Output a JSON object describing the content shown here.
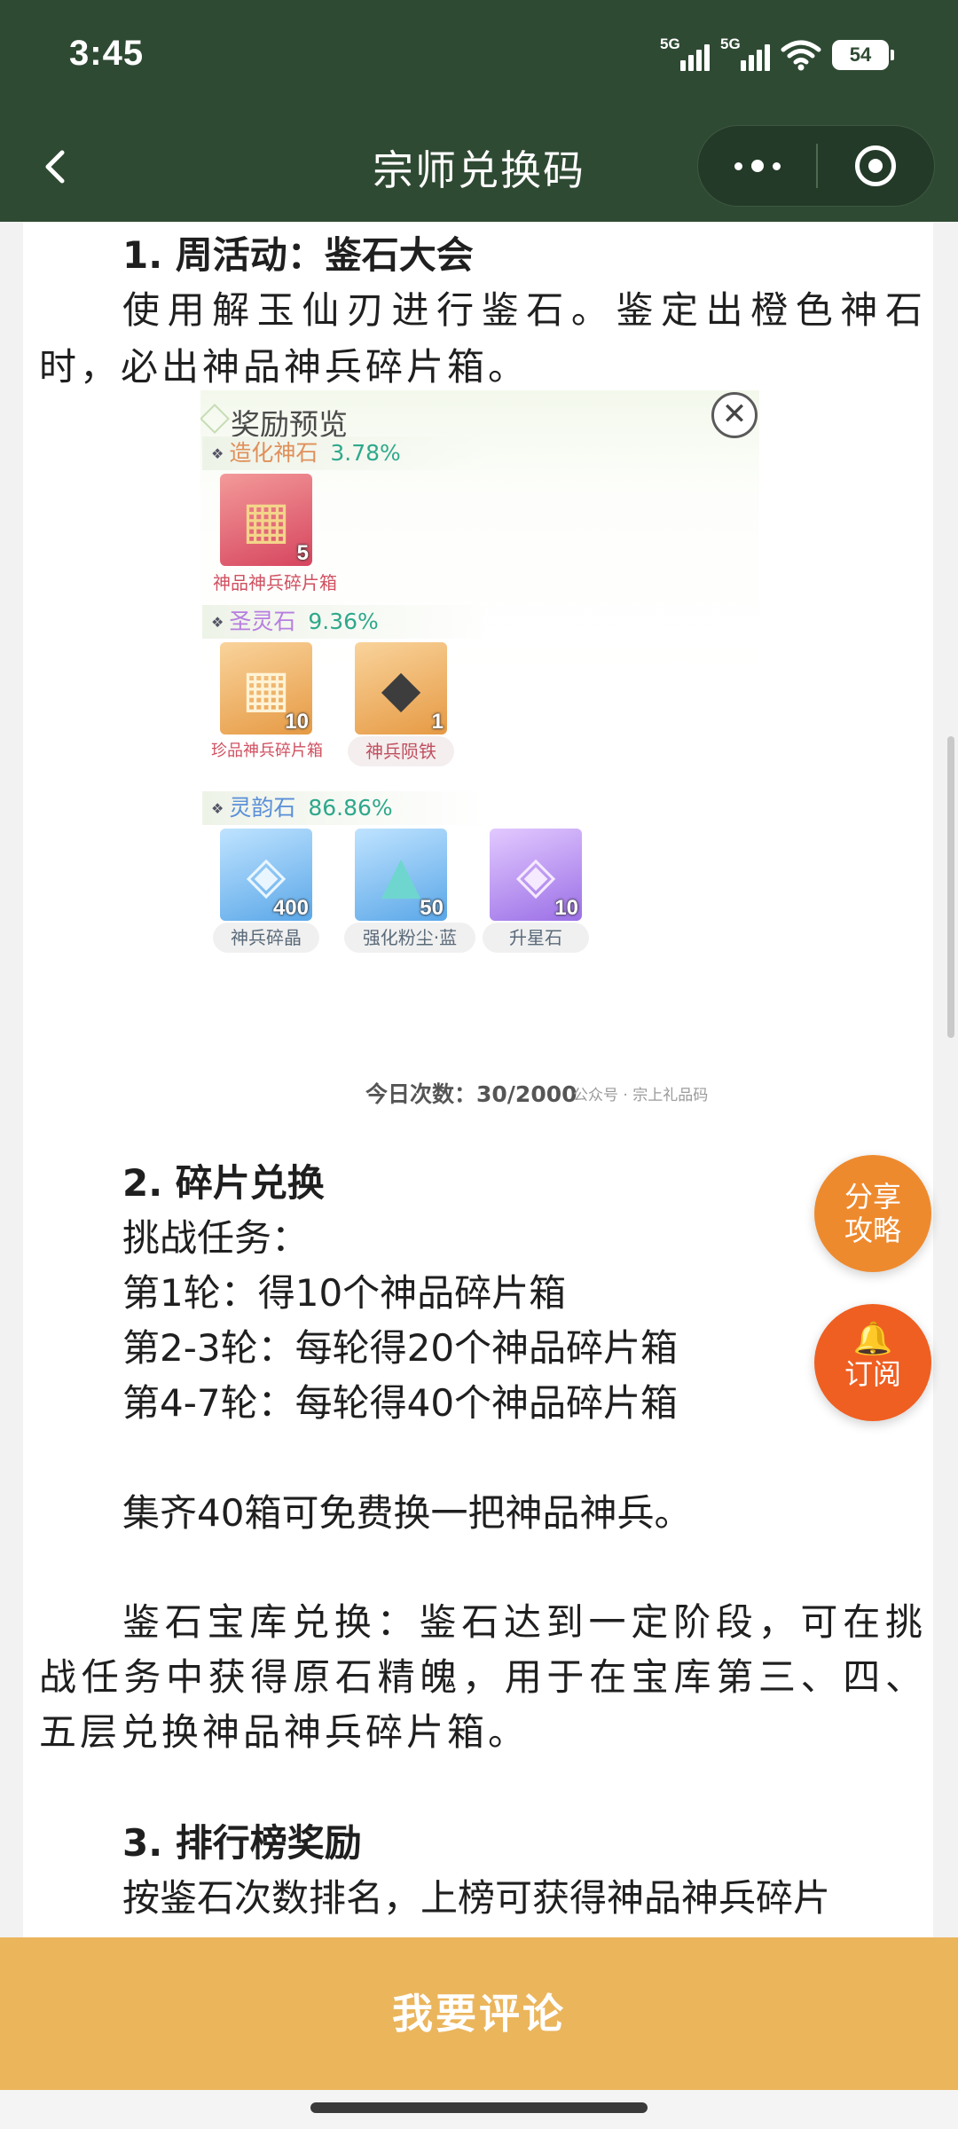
{
  "status_bar": {
    "time": "3:45",
    "network_1": "5G",
    "network_2": "5G",
    "battery": "54"
  },
  "nav": {
    "title": "宗师兑换码",
    "back_icon": "chevron-left-icon",
    "more_icon": "more-dots-icon",
    "close_icon": "target-close-icon"
  },
  "article": {
    "section1_heading": "1. 周活动：鉴石大会",
    "section1_body": "使用解玉仙刃进行鉴石。鉴定出橙色神石时，必出神品神兵碎片箱。",
    "reward_preview": {
      "title": "奖励预览",
      "categories": [
        {
          "name": "造化神石",
          "percent": "3.78%",
          "items": [
            {
              "label": "神品神兵碎片箱",
              "count": "5"
            }
          ]
        },
        {
          "name": "圣灵石",
          "percent": "9.36%",
          "items": [
            {
              "label": "珍品神兵碎片箱",
              "count": "10"
            },
            {
              "label": "神兵陨铁",
              "count": "1"
            }
          ]
        },
        {
          "name": "灵韵石",
          "percent": "86.86%",
          "items": [
            {
              "label": "神兵碎晶",
              "count": "400"
            },
            {
              "label": "强化粉尘·蓝",
              "count": "50"
            },
            {
              "label": "升星石",
              "count": "10"
            }
          ]
        }
      ],
      "daily_count": "今日次数：30/2000",
      "watermark": "公众号 · 宗上礼品码"
    },
    "section2_heading": "2. 碎片兑换",
    "section2_lines": [
      "挑战任务：",
      "第1轮：得10个神品碎片箱",
      "第2-3轮：每轮得20个神品碎片箱",
      "第4-7轮：每轮得40个神品碎片箱"
    ],
    "section2_note": "集齐40箱可免费换一把神品神兵。",
    "section2_vault": "鉴石宝库兑换：鉴石达到一定阶段，可在挑战任务中获得原石精魄，用于在宝库第三、四、五层兑换神品神兵碎片箱。",
    "section3_heading": "3. 排行榜奖励",
    "section3_cut": "按鉴石次数排名，上榜可获得神品神兵碎片"
  },
  "fab": {
    "share_label_1": "分享",
    "share_label_2": "攻略",
    "subscribe_icon": "bell-icon",
    "subscribe_label": "订阅"
  },
  "comment_bar": {
    "label": "我要评论"
  }
}
